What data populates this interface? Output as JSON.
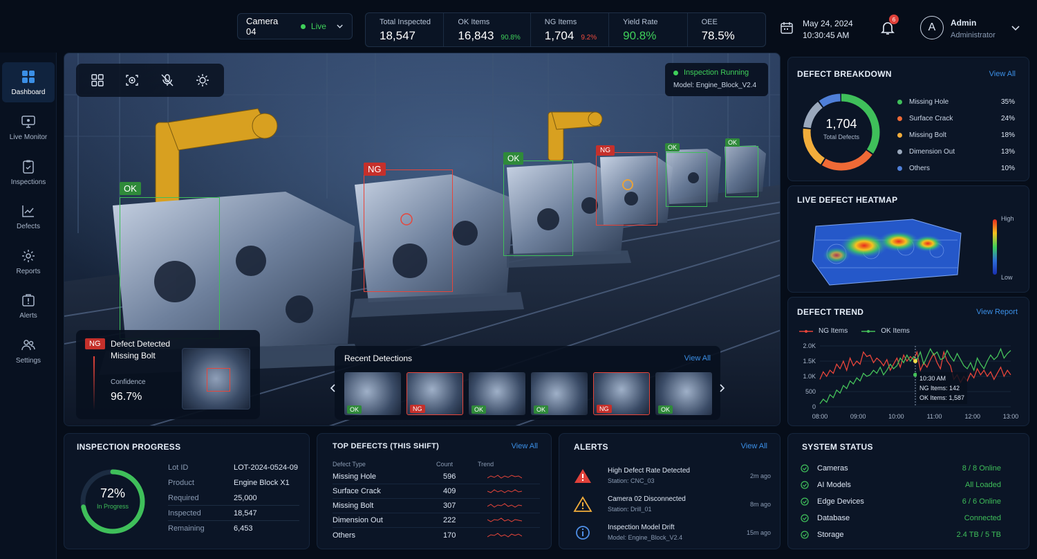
{
  "topbar": {
    "camera": "Camera 04",
    "camera_status": "Live",
    "stats": [
      {
        "label": "Total Inspected",
        "value": "18,547",
        "pct": ""
      },
      {
        "label": "OK Items",
        "value": "16,843",
        "pct": "90.8%"
      },
      {
        "label": "NG Items",
        "value": "1,704",
        "pct": "9.2%"
      },
      {
        "label": "Yield Rate",
        "value": "90.8%",
        "pct": ""
      },
      {
        "label": "OEE",
        "value": "78.5%",
        "pct": ""
      }
    ],
    "date": "May 24, 2024",
    "time": "10:30:45 AM",
    "notifications": "6",
    "user_initial": "A",
    "user_name": "Admin",
    "user_role": "Administrator"
  },
  "sidebar": {
    "items": [
      {
        "label": "Dashboard",
        "icon": "grid-icon"
      },
      {
        "label": "Live Monitor",
        "icon": "monitor-icon"
      },
      {
        "label": "Inspections",
        "icon": "clipboard-check-icon"
      },
      {
        "label": "Defects",
        "icon": "chart-line-icon"
      },
      {
        "label": "Reports",
        "icon": "gear-report-icon"
      },
      {
        "label": "Alerts",
        "icon": "alert-icon"
      },
      {
        "label": "Settings",
        "icon": "users-icon"
      }
    ]
  },
  "camera": {
    "status": "Inspection Running",
    "model": "Model: Engine_Block_V2.4",
    "tags": [
      "OK",
      "NG",
      "OK",
      "NG",
      "OK",
      "OK"
    ],
    "detection": {
      "badge": "NG",
      "title": "Defect Detected",
      "defect": "Missing Bolt",
      "confidence_label": "Confidence",
      "confidence": "96.7%"
    },
    "recent": {
      "title": "Recent Detections",
      "view_all": "View All",
      "items": [
        "OK",
        "NG",
        "OK",
        "OK",
        "NG",
        "OK"
      ]
    }
  },
  "breakdown": {
    "title": "DEFECT BREAKDOWN",
    "view_all": "View All",
    "total": "1,704",
    "total_label": "Total Defects",
    "items": [
      {
        "name": "Missing Hole",
        "pct": "35%",
        "value": 35,
        "color": "#3fbf5a"
      },
      {
        "name": "Surface Crack",
        "pct": "24%",
        "value": 24,
        "color": "#ef6a36"
      },
      {
        "name": "Missing Bolt",
        "pct": "18%",
        "value": 18,
        "color": "#f2ad3b"
      },
      {
        "name": "Dimension Out",
        "pct": "13%",
        "value": 13,
        "color": "#9aa8bc"
      },
      {
        "name": "Others",
        "pct": "10%",
        "value": 10,
        "color": "#4f7fd8"
      }
    ]
  },
  "heatmap": {
    "title": "LIVE DEFECT HEATMAP",
    "high": "High",
    "low": "Low"
  },
  "trend": {
    "title": "DEFECT TREND",
    "view_report": "View Report",
    "legend_ng": "NG Items",
    "legend_ok": "OK Items",
    "tooltip_time": "10:30 AM",
    "tooltip_ng": "NG Items: 142",
    "tooltip_ok": "OK Items: 1,587"
  },
  "chart_data": {
    "type": "line",
    "x": [
      "08:00",
      "09:00",
      "10:00",
      "11:00",
      "12:00",
      "13:00"
    ],
    "yticks": [
      "2.0K",
      "1.5K",
      "1.0K",
      "500",
      "0"
    ],
    "ylim": [
      0,
      2000
    ],
    "series": [
      {
        "name": "NG Items",
        "color": "#e8453a",
        "values": [
          900,
          1150,
          1000,
          1200,
          1100,
          1400,
          1250,
          1500,
          1200,
          1600,
          1350,
          1500,
          1400,
          1800,
          1650,
          1700,
          1450,
          1600,
          1500,
          1350,
          1550,
          1200,
          1400,
          1600,
          1300,
          1700,
          1500,
          1650,
          1550,
          1800,
          1200,
          1450,
          1300,
          1550,
          1750,
          1450,
          1250,
          1800,
          1500,
          1350,
          900,
          1050,
          800,
          1000,
          850,
          1100,
          950,
          1250,
          1050,
          1200,
          1000,
          1150,
          900,
          1100,
          1300,
          1000,
          1200,
          1050
        ]
      },
      {
        "name": "OK Items",
        "color": "#45c25a",
        "values": [
          100,
          250,
          150,
          400,
          300,
          550,
          450,
          700,
          600,
          850,
          750,
          950,
          850,
          1100,
          1000,
          1050,
          1200,
          1100,
          1300,
          1050,
          1200,
          1400,
          1250,
          1350,
          1600,
          1450,
          1700,
          1500,
          1650,
          1550,
          1800,
          1400,
          1650,
          1900,
          1700,
          1800,
          1550,
          1600,
          1850,
          1650,
          1500,
          1750,
          1550,
          1350,
          1250,
          1450,
          1200,
          1600,
          1400,
          1250,
          1500,
          1700,
          1550,
          1650,
          1900,
          1600,
          1750,
          1850
        ]
      }
    ]
  },
  "progress": {
    "title": "INSPECTION PROGRESS",
    "percent": "72%",
    "percent_value": 0.72,
    "status": "In Progress",
    "rows": [
      {
        "label": "Lot ID",
        "value": "LOT-2024-0524-09"
      },
      {
        "label": "Product",
        "value": "Engine Block X1"
      },
      {
        "label": "Required",
        "value": "25,000"
      },
      {
        "label": "Inspected",
        "value": "18,547"
      },
      {
        "label": "Remaining",
        "value": "6,453"
      }
    ]
  },
  "top_defects": {
    "title": "TOP DEFECTS (THIS SHIFT)",
    "view_all": "View All",
    "col_type": "Defect Type",
    "col_count": "Count",
    "col_trend": "Trend",
    "rows": [
      {
        "type": "Missing Hole",
        "count": "596"
      },
      {
        "type": "Surface Crack",
        "count": "409"
      },
      {
        "type": "Missing Bolt",
        "count": "307"
      },
      {
        "type": "Dimension Out",
        "count": "222"
      },
      {
        "type": "Others",
        "count": "170"
      }
    ]
  },
  "alerts": {
    "title": "ALERTS",
    "view_all": "View All",
    "items": [
      {
        "title": "High Defect Rate Detected",
        "sub": "Station: CNC_03",
        "time": "2m ago",
        "icon": "error-triangle-icon"
      },
      {
        "title": "Camera 02 Disconnected",
        "sub": "Station: Drill_01",
        "time": "8m ago",
        "icon": "warning-triangle-icon"
      },
      {
        "title": "Inspection Model Drift",
        "sub": "Model: Engine_Block_V2.4",
        "time": "15m ago",
        "icon": "info-icon"
      }
    ]
  },
  "system": {
    "title": "SYSTEM STATUS",
    "items": [
      {
        "name": "Cameras",
        "value": "8 / 8 Online"
      },
      {
        "name": "AI Models",
        "value": "All Loaded"
      },
      {
        "name": "Edge Devices",
        "value": "6 / 6 Online"
      },
      {
        "name": "Database",
        "value": "Connected"
      },
      {
        "name": "Storage",
        "value": "2.4 TB / 5 TB"
      }
    ]
  }
}
